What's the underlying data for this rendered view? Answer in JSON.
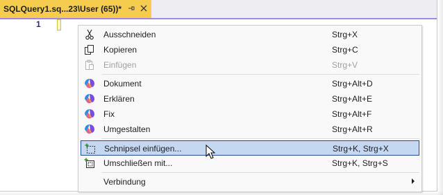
{
  "tab": {
    "title": "SQLQuery1.sq...23\\User (65))*",
    "pin_icon": "pin-icon",
    "close_icon": "close-icon"
  },
  "editor": {
    "line_number": "1"
  },
  "menu": {
    "items": [
      {
        "label": "Ausschneiden",
        "shortcut": "Strg+X",
        "icon": "scissors-icon",
        "enabled": true
      },
      {
        "label": "Kopieren",
        "shortcut": "Strg+C",
        "icon": "copy-icon",
        "enabled": true
      },
      {
        "label": "Einfügen",
        "shortcut": "Strg+V",
        "icon": "paste-icon",
        "enabled": false
      },
      {
        "label": "Dokument",
        "shortcut": "Strg+Alt+D",
        "icon": "copilot-icon",
        "enabled": true
      },
      {
        "label": "Erklären",
        "shortcut": "Strg+Alt+E",
        "icon": "copilot-icon",
        "enabled": true
      },
      {
        "label": "Fix",
        "shortcut": "Strg+Alt+F",
        "icon": "copilot-icon",
        "enabled": true
      },
      {
        "label": "Umgestalten",
        "shortcut": "Strg+Alt+R",
        "icon": "copilot-icon",
        "enabled": true
      },
      {
        "label": "Schnipsel einfügen...",
        "shortcut": "Strg+K, Strg+X",
        "icon": "insert-snippet-icon",
        "enabled": true,
        "selected": true
      },
      {
        "label": "Umschließen mit...",
        "shortcut": "Strg+K, Strg+S",
        "icon": "surround-with-icon",
        "enabled": true
      },
      {
        "label": "Verbindung",
        "shortcut": "",
        "icon": "",
        "enabled": true,
        "submenu": true
      }
    ]
  },
  "colors": {
    "tab_active": "#f5cc4e",
    "accent": "#9a8cd8",
    "selection_bg": "#c5d8f2",
    "selection_border": "#1e4d96"
  }
}
